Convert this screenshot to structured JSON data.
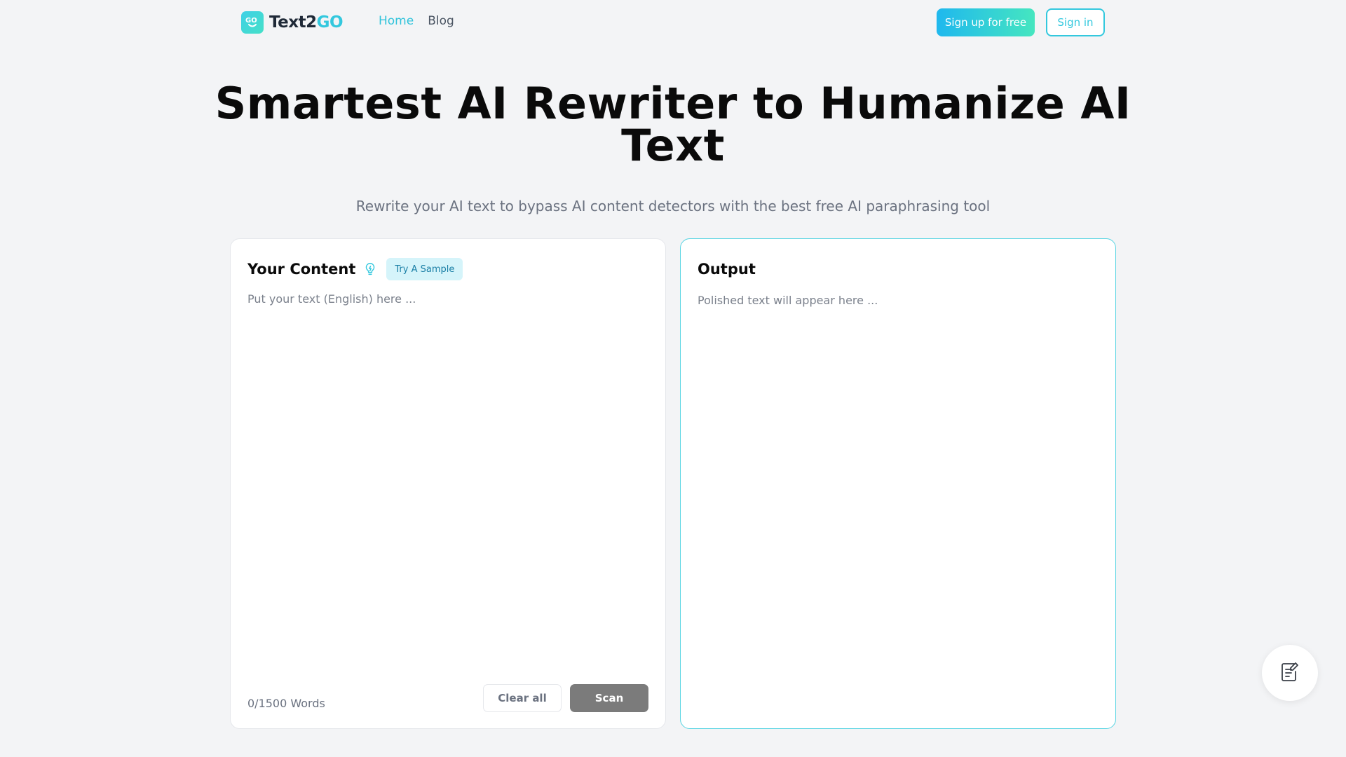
{
  "brand": {
    "name_prefix": "Text2",
    "name_suffix": "GO",
    "accent": "#33c8de"
  },
  "nav": {
    "links": [
      {
        "label": "Home",
        "active": true
      },
      {
        "label": "Blog",
        "active": false
      }
    ],
    "signup_label": "Sign up for free",
    "signin_label": "Sign in"
  },
  "hero": {
    "title": "Smartest AI Rewriter to Humanize AI Text",
    "subtitle": "Rewrite your AI text to bypass AI content detectors with the best free AI paraphrasing tool"
  },
  "input_panel": {
    "title": "Your Content",
    "hint_icon": "lightbulb-icon",
    "sample_button": "Try A Sample",
    "placeholder": "Put your text (English) here ...",
    "word_count": "0/1500 Words",
    "clear_button": "Clear all",
    "scan_button": "Scan"
  },
  "output_panel": {
    "title": "Output",
    "placeholder": "Polished text will appear here ..."
  },
  "floating_button": {
    "icon": "document-edit-icon"
  }
}
